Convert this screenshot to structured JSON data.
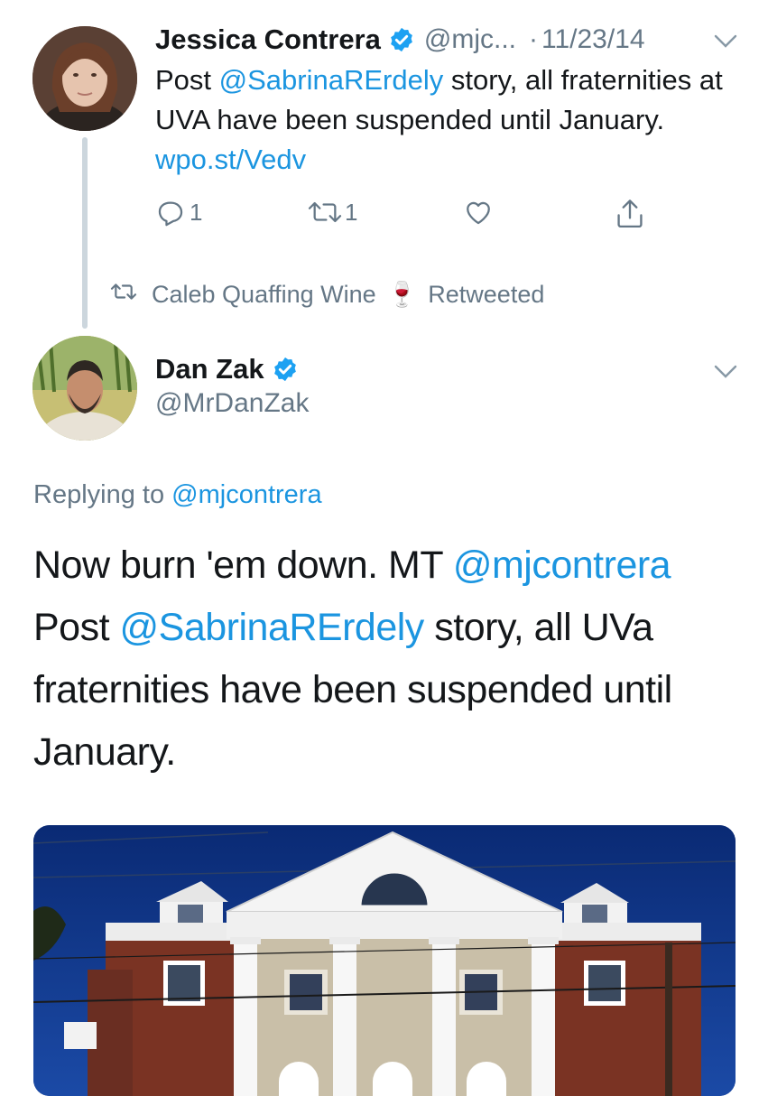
{
  "parent_tweet": {
    "author_name": "Jessica Contrera",
    "author_handle": "@mjc...",
    "separator": "·",
    "date": "11/23/14",
    "text_parts": {
      "t1": "Post ",
      "mention": "@SabrinaRErdely",
      "t2": " story, all fraternities at UVA have been suspended until January. ",
      "link": "wpo.st/Vedv"
    },
    "reply_count": "1",
    "retweet_count": "1"
  },
  "retweet_context": {
    "user": "Caleb Quaffing Wine",
    "emoji": "🍷",
    "label": "Retweeted"
  },
  "main_tweet": {
    "author_name": "Dan Zak",
    "author_handle": "@MrDanZak",
    "replying_prefix": "Replying to ",
    "replying_to": "@mjcontrera",
    "text_parts": {
      "t1": "Now burn 'em down. MT ",
      "mention1": "@mjcontrera",
      "t2": " Post ",
      "mention2": "@SabrinaRErdely",
      "t3": " story, all UVa fraternities have been suspended until January."
    }
  },
  "icons": [
    "verified-badge-icon",
    "chevron-down-icon",
    "reply-icon",
    "retweet-icon",
    "like-icon",
    "share-icon",
    "retweet-small-icon",
    "wine-glass-icon"
  ],
  "colors": {
    "link": "#1b95e0",
    "secondary_text": "#657786",
    "primary_text": "#14171a",
    "thread_line": "#ccd6dd",
    "verified": "#1da1f2"
  }
}
